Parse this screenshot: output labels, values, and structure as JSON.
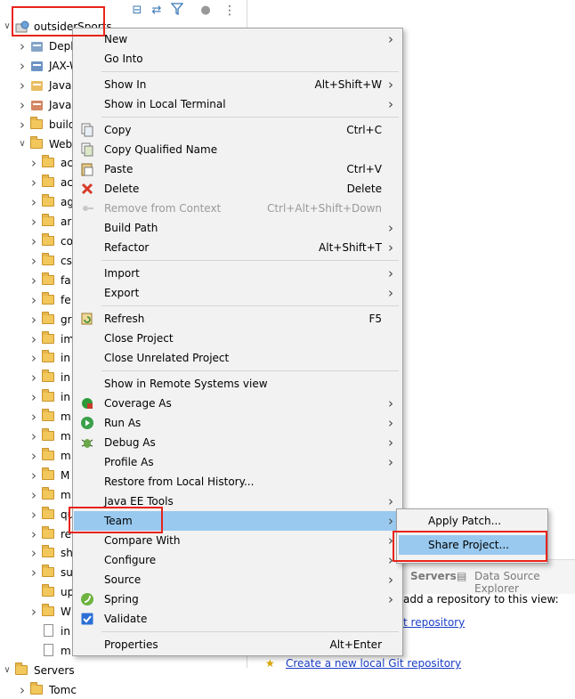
{
  "tree": {
    "project_label": "outsiderSports",
    "rows": [
      {
        "label": "Deplo",
        "depth": 1,
        "kind": "deploy"
      },
      {
        "label": "JAX-W",
        "depth": 1,
        "kind": "jax"
      },
      {
        "label": "Java",
        "depth": 1,
        "kind": "java"
      },
      {
        "label": "JavaS",
        "depth": 1,
        "kind": "javas"
      },
      {
        "label": "build",
        "depth": 1,
        "kind": "folder"
      },
      {
        "label": "WebC",
        "depth": 1,
        "kind": "folder",
        "open": true
      },
      {
        "label": "ac",
        "depth": 2,
        "kind": "folder"
      },
      {
        "label": "ac",
        "depth": 2,
        "kind": "folder"
      },
      {
        "label": "ag",
        "depth": 2,
        "kind": "folder"
      },
      {
        "label": "ar",
        "depth": 2,
        "kind": "folder"
      },
      {
        "label": "co",
        "depth": 2,
        "kind": "folder"
      },
      {
        "label": "cs",
        "depth": 2,
        "kind": "folder"
      },
      {
        "label": "fa",
        "depth": 2,
        "kind": "folder"
      },
      {
        "label": "fe",
        "depth": 2,
        "kind": "folder"
      },
      {
        "label": "gr",
        "depth": 2,
        "kind": "folder"
      },
      {
        "label": "im",
        "depth": 2,
        "kind": "folder"
      },
      {
        "label": "in",
        "depth": 2,
        "kind": "folder"
      },
      {
        "label": "in",
        "depth": 2,
        "kind": "folder"
      },
      {
        "label": "in",
        "depth": 2,
        "kind": "folder"
      },
      {
        "label": "m",
        "depth": 2,
        "kind": "folder"
      },
      {
        "label": "m",
        "depth": 2,
        "kind": "folder"
      },
      {
        "label": "m",
        "depth": 2,
        "kind": "folder"
      },
      {
        "label": "M",
        "depth": 2,
        "kind": "folder"
      },
      {
        "label": "m",
        "depth": 2,
        "kind": "folder"
      },
      {
        "label": "qu",
        "depth": 2,
        "kind": "folder"
      },
      {
        "label": "re",
        "depth": 2,
        "kind": "folder"
      },
      {
        "label": "sh",
        "depth": 2,
        "kind": "folder"
      },
      {
        "label": "su",
        "depth": 2,
        "kind": "folder"
      },
      {
        "label": "up",
        "depth": 2,
        "kind": "folder",
        "leaf": true
      },
      {
        "label": "W",
        "depth": 2,
        "kind": "folder"
      },
      {
        "label": "in",
        "depth": 2,
        "kind": "file"
      },
      {
        "label": "m",
        "depth": 2,
        "kind": "file"
      },
      {
        "label": "Servers",
        "depth": 0,
        "kind": "folder",
        "open": true
      },
      {
        "label": "Tomc",
        "depth": 1,
        "kind": "folder"
      }
    ]
  },
  "context_menu": {
    "items": [
      {
        "label": "New",
        "shortcut": "",
        "submenu": true,
        "icon": ""
      },
      {
        "label": "Go Into",
        "shortcut": "",
        "submenu": false,
        "icon": ""
      },
      {
        "sep": true
      },
      {
        "label": "Show In",
        "shortcut": "Alt+Shift+W",
        "submenu": true,
        "icon": ""
      },
      {
        "label": "Show in Local Terminal",
        "shortcut": "",
        "submenu": true,
        "icon": ""
      },
      {
        "sep": true
      },
      {
        "label": "Copy",
        "shortcut": "Ctrl+C",
        "submenu": false,
        "icon": "copy-icon"
      },
      {
        "label": "Copy Qualified Name",
        "shortcut": "",
        "submenu": false,
        "icon": "copy-qualified-icon"
      },
      {
        "label": "Paste",
        "shortcut": "Ctrl+V",
        "submenu": false,
        "icon": "paste-icon"
      },
      {
        "label": "Delete",
        "shortcut": "Delete",
        "submenu": false,
        "icon": "delete-icon"
      },
      {
        "label": "Remove from Context",
        "shortcut": "Ctrl+Alt+Shift+Down",
        "submenu": false,
        "icon": "remove-context-icon",
        "disabled": true
      },
      {
        "label": "Build Path",
        "shortcut": "",
        "submenu": true,
        "icon": ""
      },
      {
        "label": "Refactor",
        "shortcut": "Alt+Shift+T",
        "submenu": true,
        "icon": ""
      },
      {
        "sep": true
      },
      {
        "label": "Import",
        "shortcut": "",
        "submenu": true,
        "icon": ""
      },
      {
        "label": "Export",
        "shortcut": "",
        "submenu": true,
        "icon": ""
      },
      {
        "sep": true
      },
      {
        "label": "Refresh",
        "shortcut": "F5",
        "submenu": false,
        "icon": "refresh-icon"
      },
      {
        "label": "Close Project",
        "shortcut": "",
        "submenu": false,
        "icon": ""
      },
      {
        "label": "Close Unrelated Project",
        "shortcut": "",
        "submenu": false,
        "icon": ""
      },
      {
        "sep": true
      },
      {
        "label": "Show in Remote Systems view",
        "shortcut": "",
        "submenu": false,
        "icon": ""
      },
      {
        "label": "Coverage As",
        "shortcut": "",
        "submenu": true,
        "icon": "coverage-icon"
      },
      {
        "label": "Run As",
        "shortcut": "",
        "submenu": true,
        "icon": "run-icon"
      },
      {
        "label": "Debug As",
        "shortcut": "",
        "submenu": true,
        "icon": "debug-icon"
      },
      {
        "label": "Profile As",
        "shortcut": "",
        "submenu": true,
        "icon": ""
      },
      {
        "label": "Restore from Local History...",
        "shortcut": "",
        "submenu": false,
        "icon": ""
      },
      {
        "label": "Java EE Tools",
        "shortcut": "",
        "submenu": true,
        "icon": ""
      },
      {
        "label": "Team",
        "shortcut": "",
        "submenu": true,
        "icon": "",
        "highlighted": true
      },
      {
        "label": "Compare With",
        "shortcut": "",
        "submenu": true,
        "icon": ""
      },
      {
        "label": "Configure",
        "shortcut": "",
        "submenu": true,
        "icon": ""
      },
      {
        "label": "Source",
        "shortcut": "",
        "submenu": true,
        "icon": ""
      },
      {
        "label": "Spring",
        "shortcut": "",
        "submenu": true,
        "icon": "spring-icon"
      },
      {
        "label": "Validate",
        "shortcut": "",
        "submenu": false,
        "icon": "validate-checkbox-icon"
      },
      {
        "sep": true
      },
      {
        "label": "Properties",
        "shortcut": "Alt+Enter",
        "submenu": false,
        "icon": ""
      }
    ]
  },
  "team_submenu": {
    "items": [
      {
        "label": "Apply Patch..."
      },
      {
        "label": "Share Project...",
        "highlighted": true
      }
    ]
  },
  "background": {
    "tab_servers": "Servers",
    "tab_datasource": "Data Source Explorer",
    "git_text": "add a repository to this view:",
    "git_link_partial": "t repository",
    "git_create_link": "Create a new local Git repository"
  },
  "colors": {
    "highlight": "#99c9ef",
    "annotation_red": "#e8241c",
    "menu_bg": "#f2f2f2"
  }
}
